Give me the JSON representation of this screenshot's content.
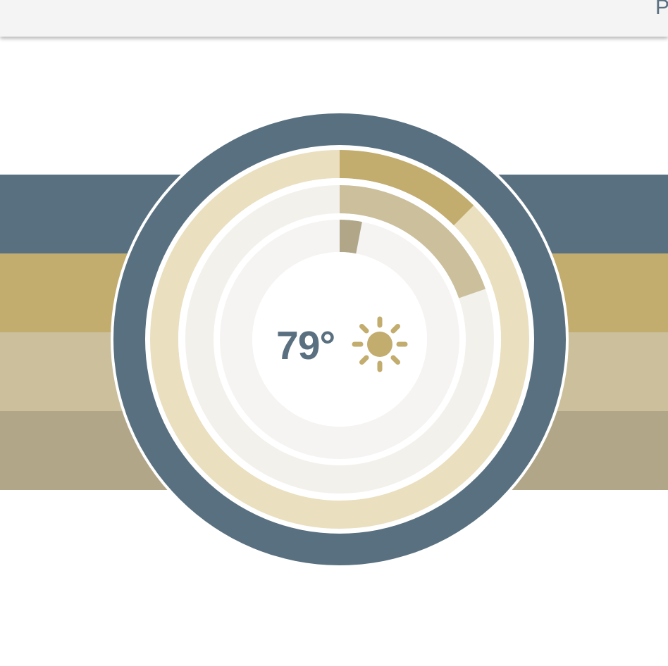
{
  "header": {
    "partial_label": "P"
  },
  "weather": {
    "temperature": "79°",
    "condition_icon": "sun-icon"
  },
  "rings": {
    "outer_progress": 0.125,
    "middle_progress": 0.197,
    "inner_progress": 0.03
  },
  "colors": {
    "slate": "#587080",
    "gold": "#c2ac6e",
    "sand": "#cbbf9c",
    "taupe": "#b1a688",
    "cream_track": "#eadfbf",
    "light_track": "#f3f1ec",
    "inner_track": "#f5f4f2"
  }
}
